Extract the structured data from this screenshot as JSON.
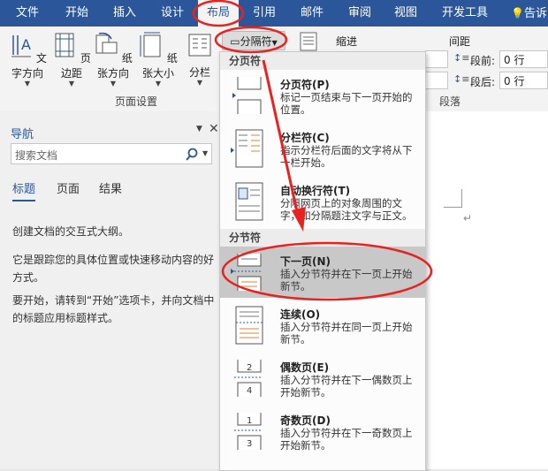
{
  "tabs": [
    {
      "label": "文件"
    },
    {
      "label": "开始"
    },
    {
      "label": "插入"
    },
    {
      "label": "设计"
    },
    {
      "label": "布局"
    },
    {
      "label": "引用"
    },
    {
      "label": "邮件"
    },
    {
      "label": "审阅"
    },
    {
      "label": "视图"
    },
    {
      "label": "开发工具"
    },
    {
      "label": "告诉我"
    }
  ],
  "ribbon": {
    "buttons": [
      {
        "label": "文字方向"
      },
      {
        "label": "页边距"
      },
      {
        "label": "纸张方向"
      },
      {
        "label": "纸张大小"
      },
      {
        "label": "分栏"
      }
    ],
    "breaks_button": "分隔符",
    "group_page_setup": "页面设置",
    "group_paragraph": "段落",
    "indent_label": "缩进",
    "spacing_label": "间距",
    "before_label": "段前:",
    "after_label": "段后:",
    "before_value": "0 行",
    "after_value": "0 行"
  },
  "nav": {
    "title": "导航",
    "search_placeholder": "搜索文档",
    "tabs": [
      "标题",
      "页面",
      "结果"
    ],
    "p1": "创建文档的交互式大纲。",
    "p2": "它是跟踪您的具体位置或快速移动内容的好方式。",
    "p3": "要开始，请转到“开始”选项卡，并向文档中的标题应用标题样式。"
  },
  "menu": {
    "section_page": "分页符",
    "section_section": "分节符",
    "items": [
      {
        "title": "分页符(P)",
        "desc": "标记一页结束与下一页开始的位置。"
      },
      {
        "title": "分栏符(C)",
        "desc": "指示分栏符后面的文字将从下一栏开始。"
      },
      {
        "title": "自动换行符(T)",
        "desc": "分隔网页上的对象周围的文字，如分隔题注文字与正文。"
      },
      {
        "title": "下一页(N)",
        "desc": "插入分节符并在下一页上开始新节。"
      },
      {
        "title": "连续(O)",
        "desc": "插入分节符并在同一页上开始新节。"
      },
      {
        "title": "偶数页(E)",
        "desc": "插入分节符并在下一偶数页上开始新节。"
      },
      {
        "title": "奇数页(D)",
        "desc": "插入分节符并在下一奇数页上开始新节。"
      }
    ]
  },
  "colors": {
    "accent": "#2b579a",
    "annotation": "#e8231f"
  }
}
